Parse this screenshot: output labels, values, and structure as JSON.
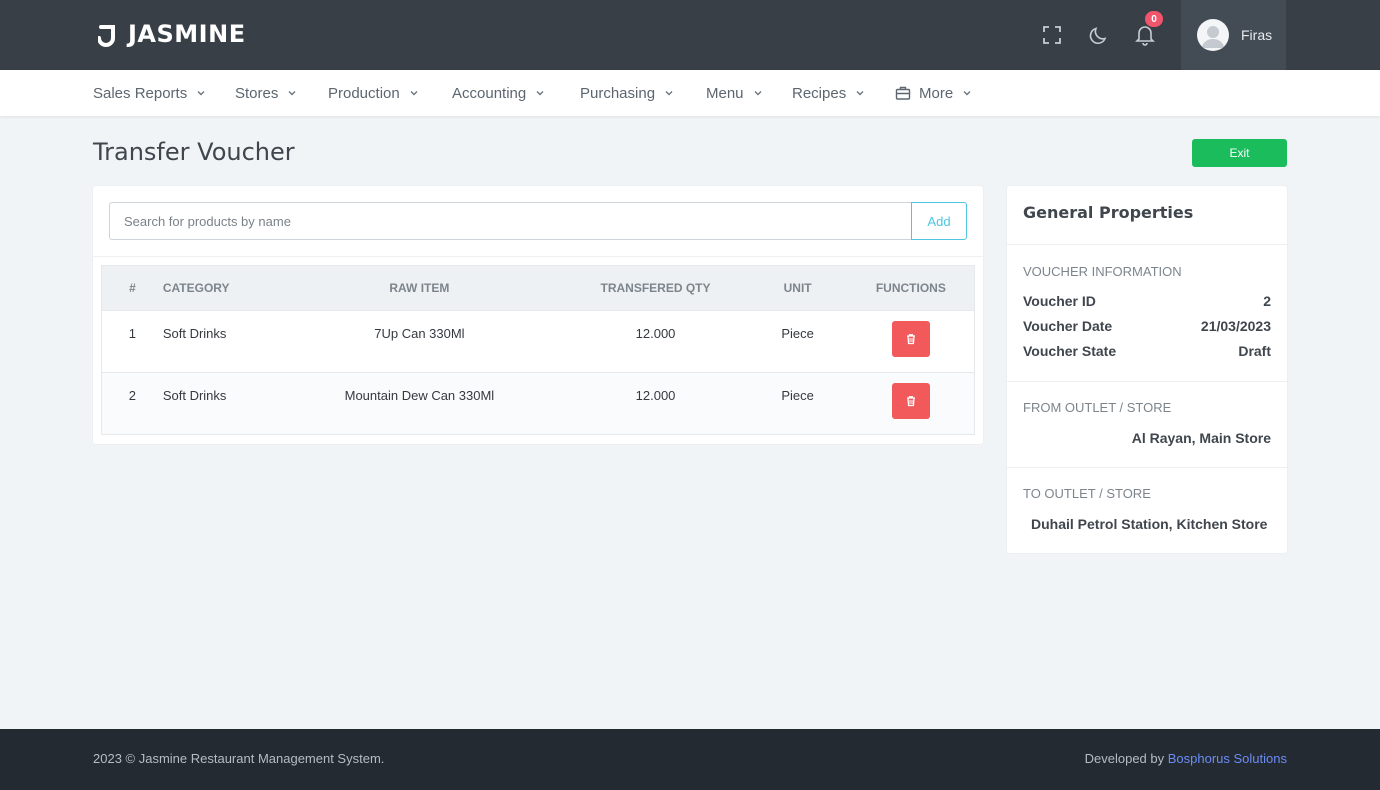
{
  "brand": {
    "name": "JASMINE"
  },
  "topbar": {
    "notification_count": "0",
    "user_name": "Firas",
    "icons": [
      "fullscreen-icon",
      "moon-icon",
      "bell-icon",
      "user-avatar-icon"
    ]
  },
  "nav": {
    "items": [
      {
        "label": "Sales Reports"
      },
      {
        "label": "Stores"
      },
      {
        "label": "Production"
      },
      {
        "label": "Accounting"
      },
      {
        "label": "Purchasing"
      },
      {
        "label": "Menu"
      },
      {
        "label": "Recipes"
      },
      {
        "label": "More",
        "icon": "briefcase-icon"
      }
    ]
  },
  "page": {
    "title": "Transfer Voucher",
    "exit_label": "Exit"
  },
  "search": {
    "placeholder": "Search for products by name",
    "value": "",
    "add_label": "Add"
  },
  "table": {
    "headers": [
      "#",
      "CATEGORY",
      "RAW ITEM",
      "TRANSFERED QTY",
      "UNIT",
      "FUNCTIONS"
    ],
    "rows": [
      {
        "num": "1",
        "category": "Soft Drinks",
        "raw_item": "7Up Can 330Ml",
        "qty": "12.000",
        "unit": "Piece"
      },
      {
        "num": "2",
        "category": "Soft Drinks",
        "raw_item": "Mountain Dew Can 330Ml",
        "qty": "12.000",
        "unit": "Piece"
      }
    ]
  },
  "side": {
    "title": "General Properties",
    "voucher_info_head": "VOUCHER INFORMATION",
    "voucher_id_label": "Voucher ID",
    "voucher_id": "2",
    "voucher_date_label": "Voucher Date",
    "voucher_date": "21/03/2023",
    "voucher_state_label": "Voucher State",
    "voucher_state": "Draft",
    "from_head": "FROM OUTLET / STORE",
    "from_value": "Al Rayan, Main Store",
    "to_head": "TO OUTLET / STORE",
    "to_value": "Duhail Petrol Station, Kitchen Store"
  },
  "footer": {
    "copyright": "2023 © Jasmine Restaurant Management System.",
    "developed_by": "Developed by ",
    "developer": "Bosphorus Solutions"
  },
  "colors": {
    "topbar": "#383f47",
    "exit": "#1abc5c",
    "delete": "#f1595b",
    "add": "#4fc6e1",
    "badge": "#f1556c",
    "link": "#6c8cf5"
  }
}
